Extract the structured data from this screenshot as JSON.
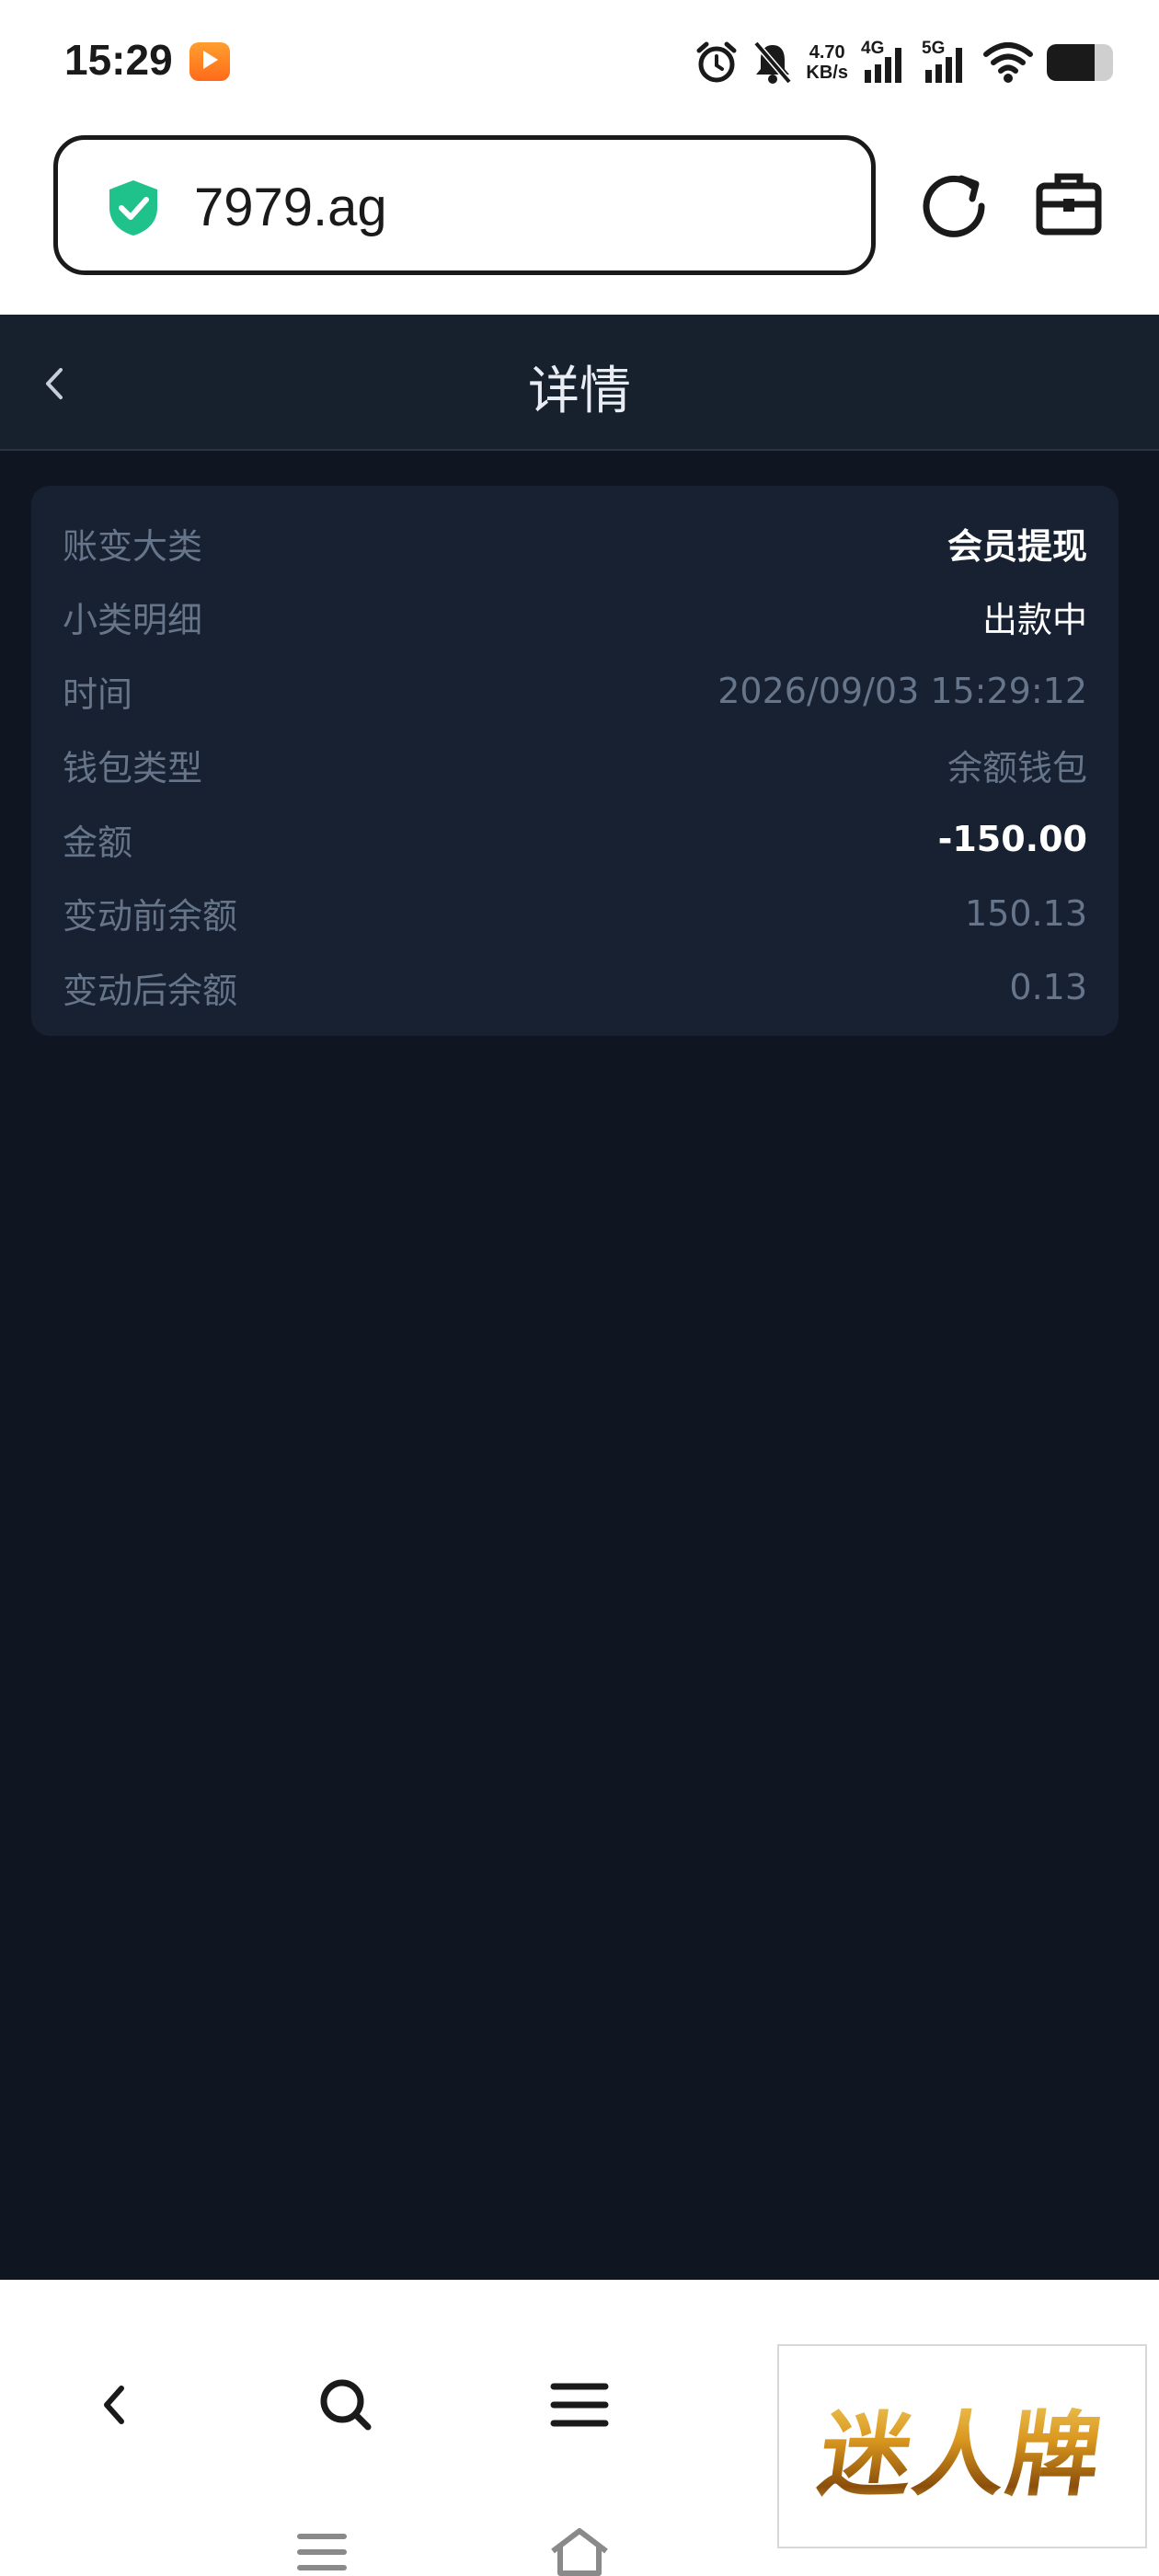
{
  "status_bar": {
    "time": "15:29",
    "app_icon": "video-app-icon",
    "speed_value": "4.70",
    "speed_unit": "KB/s",
    "net1": "4G",
    "net2": "5G",
    "battery_level": 0.72
  },
  "browser": {
    "url": "7979.ag",
    "security_icon": "shield-check-icon",
    "reload_icon": "reload-icon",
    "tools_icon": "toolbox-icon"
  },
  "page": {
    "title": "详情",
    "rows": [
      {
        "label": "账变大类",
        "value": "会员提现"
      },
      {
        "label": "小类明细",
        "value": "出款中"
      },
      {
        "label": "时间",
        "value": "2026/09/03 15:29:12"
      },
      {
        "label": "钱包类型",
        "value": "余额钱包"
      },
      {
        "label": "金额",
        "value": "-150.00"
      },
      {
        "label": "变动前余额",
        "value": "150.13"
      },
      {
        "label": "变动后余额",
        "value": "0.13"
      }
    ]
  },
  "colors": {
    "page_bg": "#101522",
    "header_bg": "#17202d",
    "card_bg": "#172131",
    "label": "#66758a",
    "highlight": "#ffffff",
    "shield": "#1fc28a"
  },
  "watermark": "迷人牌"
}
